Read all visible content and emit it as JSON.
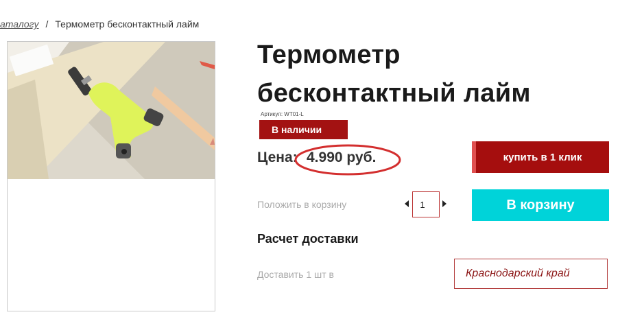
{
  "breadcrumb": {
    "catalog_link": "аталогу",
    "separator": "/",
    "current": "Термометр бесконтактный лайм"
  },
  "product": {
    "title_line1": "Термометр",
    "title_line2": "бесконтактный лайм",
    "sku": "Артикул: WT01-L",
    "stock_status": "В наличии",
    "price_label": "Цена:",
    "price_value": "4.990 руб."
  },
  "actions": {
    "buy_one_click_label": "купить в 1 клик",
    "add_to_cart_prompt": "Положить в корзину",
    "quantity": "1",
    "add_to_cart_label": "В корзину"
  },
  "delivery": {
    "heading": "Расчет доставки",
    "deliver_label": "Доставить 1 шт в",
    "region_value": "Краснодарский край"
  },
  "colors": {
    "accent_red": "#a50e0e",
    "cart_cyan": "#00d3d9",
    "price_ring": "#d32f2f"
  }
}
